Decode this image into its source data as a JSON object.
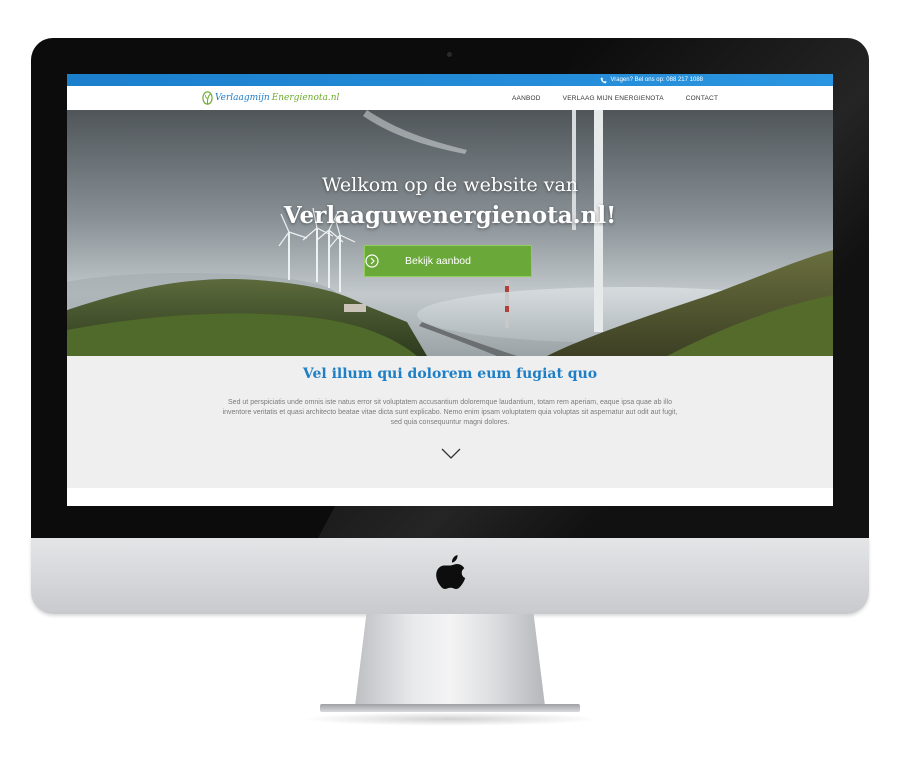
{
  "topbar": {
    "contact_text": "Vragen? Bel ons op: 088 217 1088"
  },
  "logo": {
    "part1": "Verlaagmijn",
    "part2": "Energienota.nl"
  },
  "nav": {
    "items": [
      {
        "label": "AANBOD"
      },
      {
        "label": "VERLAAG MIJN ENERGIENOTA"
      },
      {
        "label": "CONTACT"
      }
    ]
  },
  "hero": {
    "title_line1": "Welkom op de website van",
    "title_line2": "Verlaaguwenergienota.nl!",
    "cta_label": "Bekijk aanbod"
  },
  "intro": {
    "heading": "Vel illum qui dolorem eum fugiat quo",
    "body": "Sed ut perspiciatis unde omnis iste natus error sit voluptatem accusantium doloremque laudantium, totam rem aperiam, eaque ipsa quae ab illo inventore veritatis et quasi architecto beatae vitae dicta sunt explicabo. Nemo enim ipsam voluptatem quia voluptas sit aspernatur aut odit aut fugit, sed quia consequuntur magni dolores."
  },
  "colors": {
    "topbar_blue": "#1b7fcc",
    "brand_blue": "#1f7fc6",
    "brand_green": "#6aa83a",
    "intro_background": "#efefef"
  },
  "icons": [
    "phone-icon",
    "leaf-icon",
    "arrow-right-circle-icon",
    "chevron-down-icon",
    "apple-logo-icon"
  ]
}
